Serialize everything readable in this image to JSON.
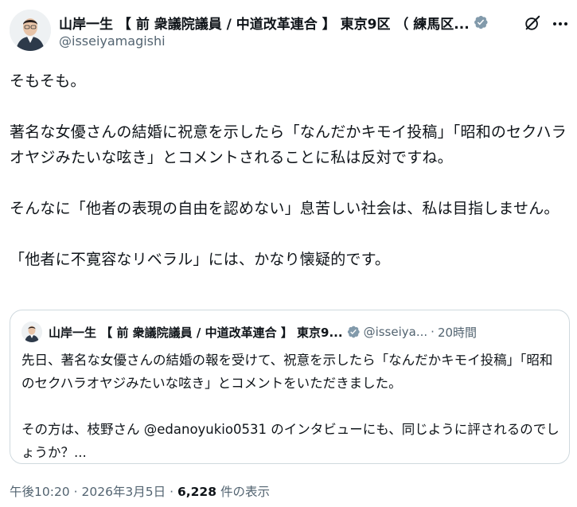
{
  "author": {
    "display_name": "山岸一生 【 前 衆議院議員 / 中道改革連合 】 東京9区 （ 練馬区...",
    "handle": "@isseiyamagishi",
    "avatar_icon": "profile-photo",
    "verified_icon": "verified-badge-icon"
  },
  "post": {
    "paragraphs": [
      "そもそも。",
      "著名な女優さんの結婚に祝意を示したら「なんだかキモイ投稿」「昭和のセクハラオヤジみたいな呟き」とコメントされることに私は反対ですね。",
      "そんなに「他者の表現の自由を認めない」息苦しい社会は、私は目指しません。",
      "「他者に不寛容なリベラル」には、かなり懐疑的です。"
    ]
  },
  "quote": {
    "display_name": "山岸一生 【 前 衆議院議員 / 中道改革連合 】 東京9...",
    "handle": "@isseiya...",
    "dot": "·",
    "time": "20時間",
    "paragraphs": [
      "先日、著名な女優さんの結婚の報を受けて、祝意を示したら「なんだかキモイ投稿」「昭和のセクハラオヤジみたいな呟き」とコメントをいただきました。",
      "その方は、枝野さん @edanoyukio0531 のインタビューにも、同じように評されるのでしょうか？..."
    ]
  },
  "meta": {
    "time": "午後10:20",
    "sep1": "·",
    "date": "2026年3月5日",
    "sep2": "·",
    "views_count": "6,228",
    "views_label": "件の表示"
  },
  "colors": {
    "verified": "#829aab",
    "text": "#0f1419",
    "secondary": "#536471",
    "border": "#cfd9de"
  }
}
